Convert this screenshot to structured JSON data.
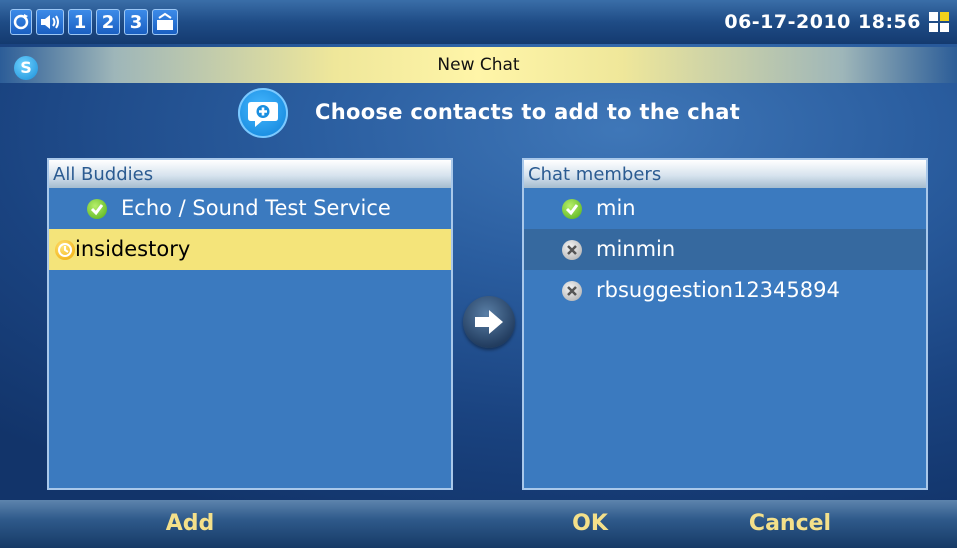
{
  "status_bar": {
    "icons": [
      "refresh-icon",
      "speaker-icon",
      "line-1",
      "line-2",
      "line-3",
      "folder-icon"
    ],
    "lines": [
      "1",
      "2",
      "3"
    ],
    "datetime": "06-17-2010 18:56",
    "network_icon": "network-icon"
  },
  "title_bar": {
    "title": "New Chat",
    "logo_letter": "S"
  },
  "heading": {
    "text": "Choose contacts to add to the chat",
    "icon": "add-chat-icon"
  },
  "left_panel": {
    "header": "All Buddies",
    "items": [
      {
        "label": "Echo / Sound Test Service",
        "status": "online"
      },
      {
        "label": "insidestory",
        "status": "away",
        "selected": true
      }
    ]
  },
  "right_panel": {
    "header": "Chat members",
    "items": [
      {
        "label": "min",
        "status": "online"
      },
      {
        "label": "minmin",
        "status": "offline",
        "highlighted": true
      },
      {
        "label": "rbsuggestion12345894",
        "status": "offline"
      }
    ]
  },
  "move_button": {
    "icon": "arrow-right-icon"
  },
  "softkeys": {
    "add": "Add",
    "ok": "OK",
    "cancel": "Cancel"
  },
  "colors": {
    "selected_row": "#f4e47a",
    "softkey_text": "#f4e08a",
    "panel": "#3b7abf"
  }
}
